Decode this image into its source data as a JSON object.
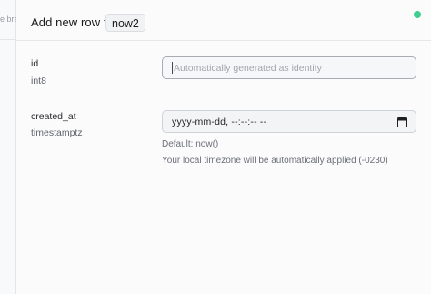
{
  "background": {
    "truncated_text": "e bra"
  },
  "header": {
    "title": "Add new row to",
    "table_name": "now2"
  },
  "fields": {
    "id": {
      "name": "id",
      "type": "int8",
      "placeholder": "Automatically generated as identity"
    },
    "created_at": {
      "name": "created_at",
      "type": "timestamptz",
      "value": "yyyy-mm-dd, --:--:-- --",
      "default_text": "Default: now()",
      "timezone_text": "Your local timezone will be automatically applied (-0230)"
    }
  },
  "colors": {
    "status_dot": "#3ecf8e"
  },
  "icons": {
    "calendar": "calendar-icon"
  }
}
